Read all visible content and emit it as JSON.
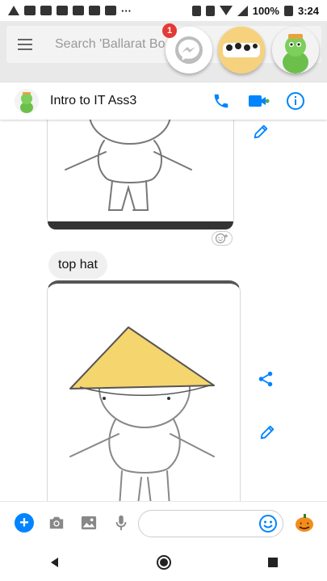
{
  "status_bar": {
    "battery": "100%",
    "time": "3:24",
    "overflow": "···"
  },
  "background_app": {
    "search_placeholder": "Search 'Ballarat Bo"
  },
  "chat_heads": {
    "badge_count": "1",
    "items": [
      "messenger-logo",
      "group-photo",
      "profile-photo"
    ]
  },
  "chat": {
    "title": "Intro to IT Ass3",
    "header_icons": [
      "phone-icon",
      "video-call-icon",
      "info-icon"
    ],
    "messages": [
      {
        "type": "image",
        "description_icon": "drawing-image"
      },
      {
        "type": "text",
        "text": "top hat"
      },
      {
        "type": "image",
        "description_icon": "drawing-image"
      }
    ]
  },
  "composer": {
    "input_value": "",
    "icons": [
      "add-icon",
      "camera-icon",
      "gallery-icon",
      "microphone-icon",
      "emoji-icon",
      "pumpkin-icon"
    ]
  },
  "nav_bar": {
    "icons": [
      "back-icon",
      "home-icon",
      "recents-icon"
    ]
  },
  "colors": {
    "accent": "#0084ff",
    "badge": "#e53935",
    "hat": "#f5d56e"
  }
}
